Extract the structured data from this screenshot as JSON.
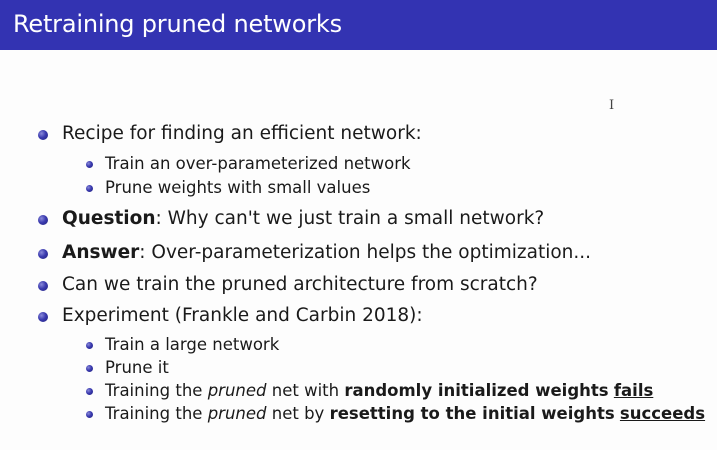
{
  "slide": {
    "title": "Retraining pruned networks",
    "cursor_glyph": "I",
    "items": [
      {
        "text": "Recipe for finding an efficient network:"
      },
      {
        "text": "Train an over-parameterized network"
      },
      {
        "text": "Prune weights with small values"
      },
      {
        "label": "Question",
        "text": ": Why can't we just train a small network?"
      },
      {
        "label": "Answer",
        "text": ": Over-parameterization helps the optimization..."
      },
      {
        "text": "Can we train the pruned architecture from scratch?"
      },
      {
        "text": "Experiment (Frankle and Carbin 2018):"
      },
      {
        "text": "Train a large network"
      },
      {
        "text": "Prune it"
      },
      {
        "pre": "Training the ",
        "em": "pruned",
        "mid": " net with ",
        "strong": "randomly initialized weights",
        "space": " ",
        "result": "fails"
      },
      {
        "pre": "Training the ",
        "em": "pruned",
        "mid": " net by ",
        "strong": "resetting to the initial weights",
        "space": " ",
        "result": "succeeds"
      }
    ]
  },
  "colors": {
    "title_bar": "#3333b2",
    "title_text": "#ffffff",
    "bullet": "#3b3bb0",
    "body_text": "#1a1a1a"
  }
}
